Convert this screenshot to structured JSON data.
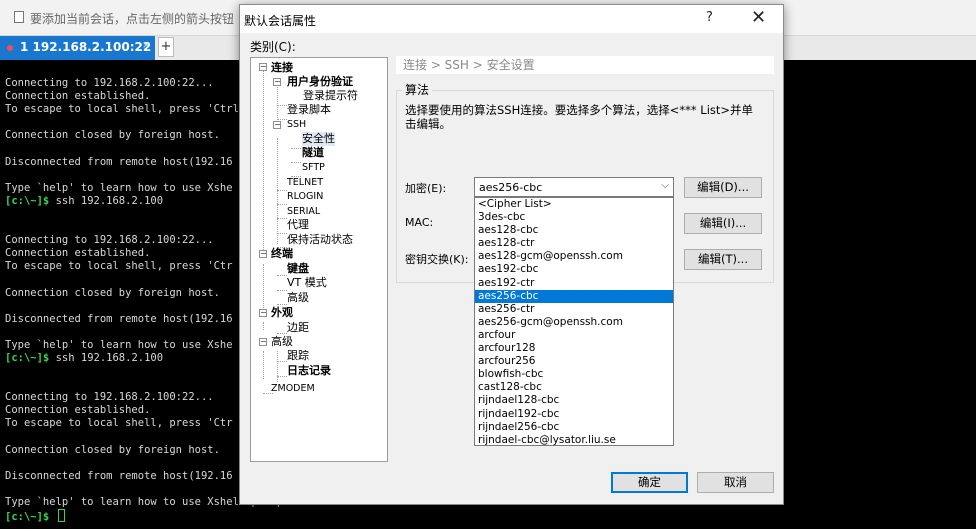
{
  "hint": {
    "text": "要添加当前会话，点击左侧的箭头按钮"
  },
  "tabs": {
    "active_label": "1 192.168.2.100:22",
    "close_glyph": "×",
    "add_glyph": "+"
  },
  "terminal": {
    "lines": [
      {
        "text": "Connecting to 192.168.2.100:22..."
      },
      {
        "text": "Connection established."
      },
      {
        "text": "To escape to local shell, press 'Ctrl"
      },
      {
        "text": ""
      },
      {
        "text": "Connection closed by foreign host."
      },
      {
        "text": ""
      },
      {
        "text": "Disconnected from remote host(192.16"
      },
      {
        "text": ""
      },
      {
        "text": "Type `help' to learn how to use Xshe"
      },
      {
        "prompt": "[c:\\~]$",
        "text": " ssh 192.168.2.100"
      },
      {
        "text": ""
      },
      {
        "text": ""
      },
      {
        "text": "Connecting to 192.168.2.100:22..."
      },
      {
        "text": "Connection established."
      },
      {
        "text": "To escape to local shell, press 'Ctr"
      },
      {
        "text": ""
      },
      {
        "text": "Connection closed by foreign host."
      },
      {
        "text": ""
      },
      {
        "text": "Disconnected from remote host(192.16"
      },
      {
        "text": ""
      },
      {
        "text": "Type `help' to learn how to use Xshe"
      },
      {
        "prompt": "[c:\\~]$",
        "text": " ssh 192.168.2.100"
      },
      {
        "text": ""
      },
      {
        "text": ""
      },
      {
        "text": "Connecting to 192.168.2.100:22..."
      },
      {
        "text": "Connection established."
      },
      {
        "text": "To escape to local shell, press 'Ctr"
      },
      {
        "text": ""
      },
      {
        "text": "Connection closed by foreign host."
      },
      {
        "text": ""
      },
      {
        "text": "Disconnected from remote host(192.16"
      },
      {
        "text": ""
      },
      {
        "text": "Type `help' to learn how to use Xshell prompt."
      },
      {
        "prompt": "[c:\\~]$",
        "text": " ",
        "cursor": true
      }
    ]
  },
  "dialog": {
    "title": "默认会话属性",
    "help": "?",
    "close": "✕",
    "category_label": "类别(C):",
    "tree": [
      {
        "label": "连接"
      },
      {
        "label": "用户身份验证"
      },
      {
        "label": "登录提示符"
      },
      {
        "label": "登录脚本"
      },
      {
        "label": "SSH"
      },
      {
        "label": "安全性"
      },
      {
        "label": "隧道"
      },
      {
        "label": "SFTP"
      },
      {
        "label": "TELNET"
      },
      {
        "label": "RLOGIN"
      },
      {
        "label": "SERIAL"
      },
      {
        "label": "代理"
      },
      {
        "label": "保持活动状态"
      },
      {
        "label": "终端"
      },
      {
        "label": "键盘"
      },
      {
        "label": "VT 模式"
      },
      {
        "label": "高级"
      },
      {
        "label": "外观"
      },
      {
        "label": "边距"
      },
      {
        "label": "高级"
      },
      {
        "label": "跟踪"
      },
      {
        "label": "日志记录"
      },
      {
        "label": "ZMODEM"
      }
    ],
    "breadcrumb": "连接 > SSH > 安全设置",
    "group_title": "算法",
    "description": "选择要使用的算法SSH连接。要选择多个算法，选择<*** List>并单击编辑。",
    "encryption": {
      "label": "加密(E):",
      "value": "aes256-cbc",
      "edit": "编辑(D)..."
    },
    "mac": {
      "label": "MAC:",
      "edit": "编辑(I)..."
    },
    "kex": {
      "label": "密钥交换(K):",
      "edit": "编辑(T)..."
    },
    "cipher_options": [
      {
        "label": "<Cipher List>"
      },
      {
        "label": "3des-cbc"
      },
      {
        "label": "aes128-cbc"
      },
      {
        "label": "aes128-ctr"
      },
      {
        "label": "aes128-gcm@openssh.com"
      },
      {
        "label": "aes192-cbc"
      },
      {
        "label": "aes192-ctr"
      },
      {
        "label": "aes256-cbc",
        "selected": true
      },
      {
        "label": "aes256-ctr"
      },
      {
        "label": "aes256-gcm@openssh.com"
      },
      {
        "label": "arcfour"
      },
      {
        "label": "arcfour128"
      },
      {
        "label": "arcfour256"
      },
      {
        "label": "blowfish-cbc"
      },
      {
        "label": "cast128-cbc"
      },
      {
        "label": "rijndael128-cbc"
      },
      {
        "label": "rijndael192-cbc"
      },
      {
        "label": "rijndael256-cbc"
      },
      {
        "label": "rijndael-cbc@lysator.liu.se"
      }
    ],
    "ok": "确定",
    "cancel": "取消"
  },
  "colors": {
    "accent": "#1a77cf",
    "selection": "#0078d7",
    "prompt": "#39d353"
  }
}
